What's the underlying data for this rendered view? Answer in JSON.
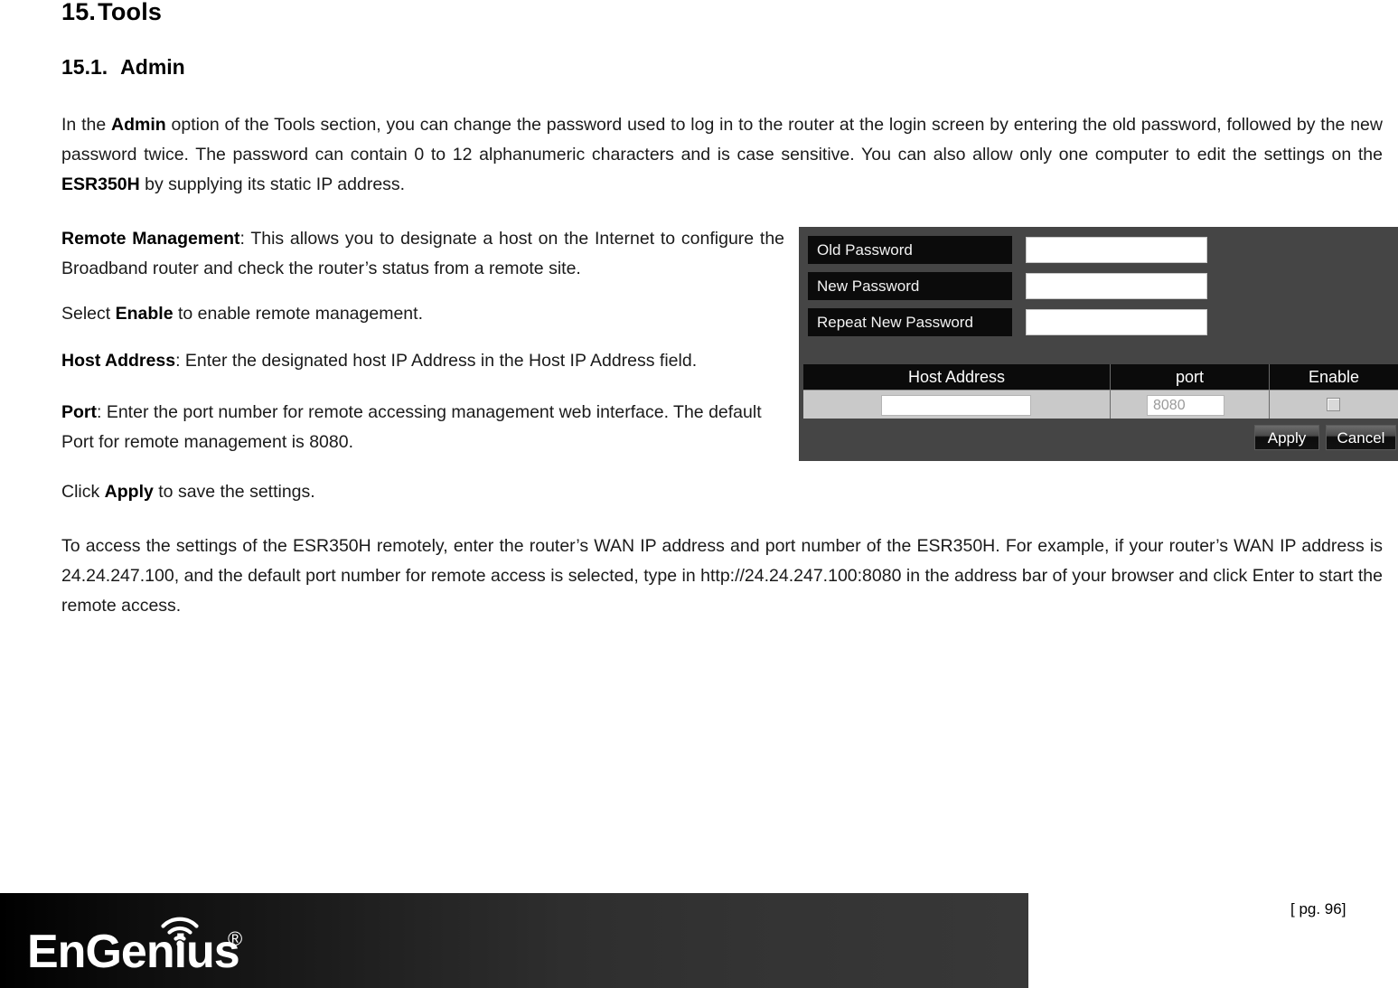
{
  "document": {
    "heading1": {
      "number": "15.",
      "text": "Tools"
    },
    "heading2": {
      "number": "15.1.",
      "text": "Admin"
    },
    "intro_paragraph": "In the Admin option of the Tools section, you can change the password used to log in to the router at the login screen by entering the old password, followed by the new password twice. The password can contain 0 to 12 alphanumeric characters and is case sensitive. You can also allow only one computer to edit the settings on the ESR350H by supplying its static IP address.",
    "intro_bold_1": "Admin",
    "intro_bold_2": "ESR350H",
    "remote_management_label": "Remote Management",
    "remote_management_text": ": This allows you to designate a host on the Internet to configure the Broadband router and check the router’s status from a remote site.",
    "select_enable_pre": "Select ",
    "select_enable_bold": "Enable",
    "select_enable_post": " to enable remote management.",
    "host_address_label": "Host Address",
    "host_address_text": ": Enter the designated host IP Address in the Host IP Address field.",
    "port_label": "Port",
    "port_text": ": Enter the port number for remote accessing management web interface. The default Port for remote management is 8080.",
    "apply_pre": "Click ",
    "apply_bold": "Apply",
    "apply_post": " to save the settings.",
    "remote_access_paragraph": "To access the settings of the ESR350H remotely, enter the router’s WAN IP address and port number of the ESR350H. For example, if your router’s WAN IP address is 24.24.247.100, and the default port number for remote access is selected, type in http://24.24.247.100:8080 in the address bar of your browser and click Enter to start the remote access."
  },
  "router_panel": {
    "password_rows": [
      {
        "label": "Old Password",
        "value": ""
      },
      {
        "label": "New Password",
        "value": ""
      },
      {
        "label": "Repeat New Password",
        "value": ""
      }
    ],
    "host_table": {
      "headers": [
        "Host Address",
        "port",
        "Enable"
      ],
      "row": {
        "host_address": "",
        "port_placeholder": "8080",
        "enable_checked": false
      }
    },
    "buttons": {
      "apply": "Apply",
      "cancel": "Cancel"
    },
    "colors": {
      "panel_background": "#454545",
      "label_background": "#0b0b0b",
      "table_row_background": "#c9c9c9",
      "input_background": "#ffffff"
    }
  },
  "footer": {
    "logo_text": "EnGenius",
    "logo_registered": "®",
    "page_label": "[ pg. 96]"
  }
}
